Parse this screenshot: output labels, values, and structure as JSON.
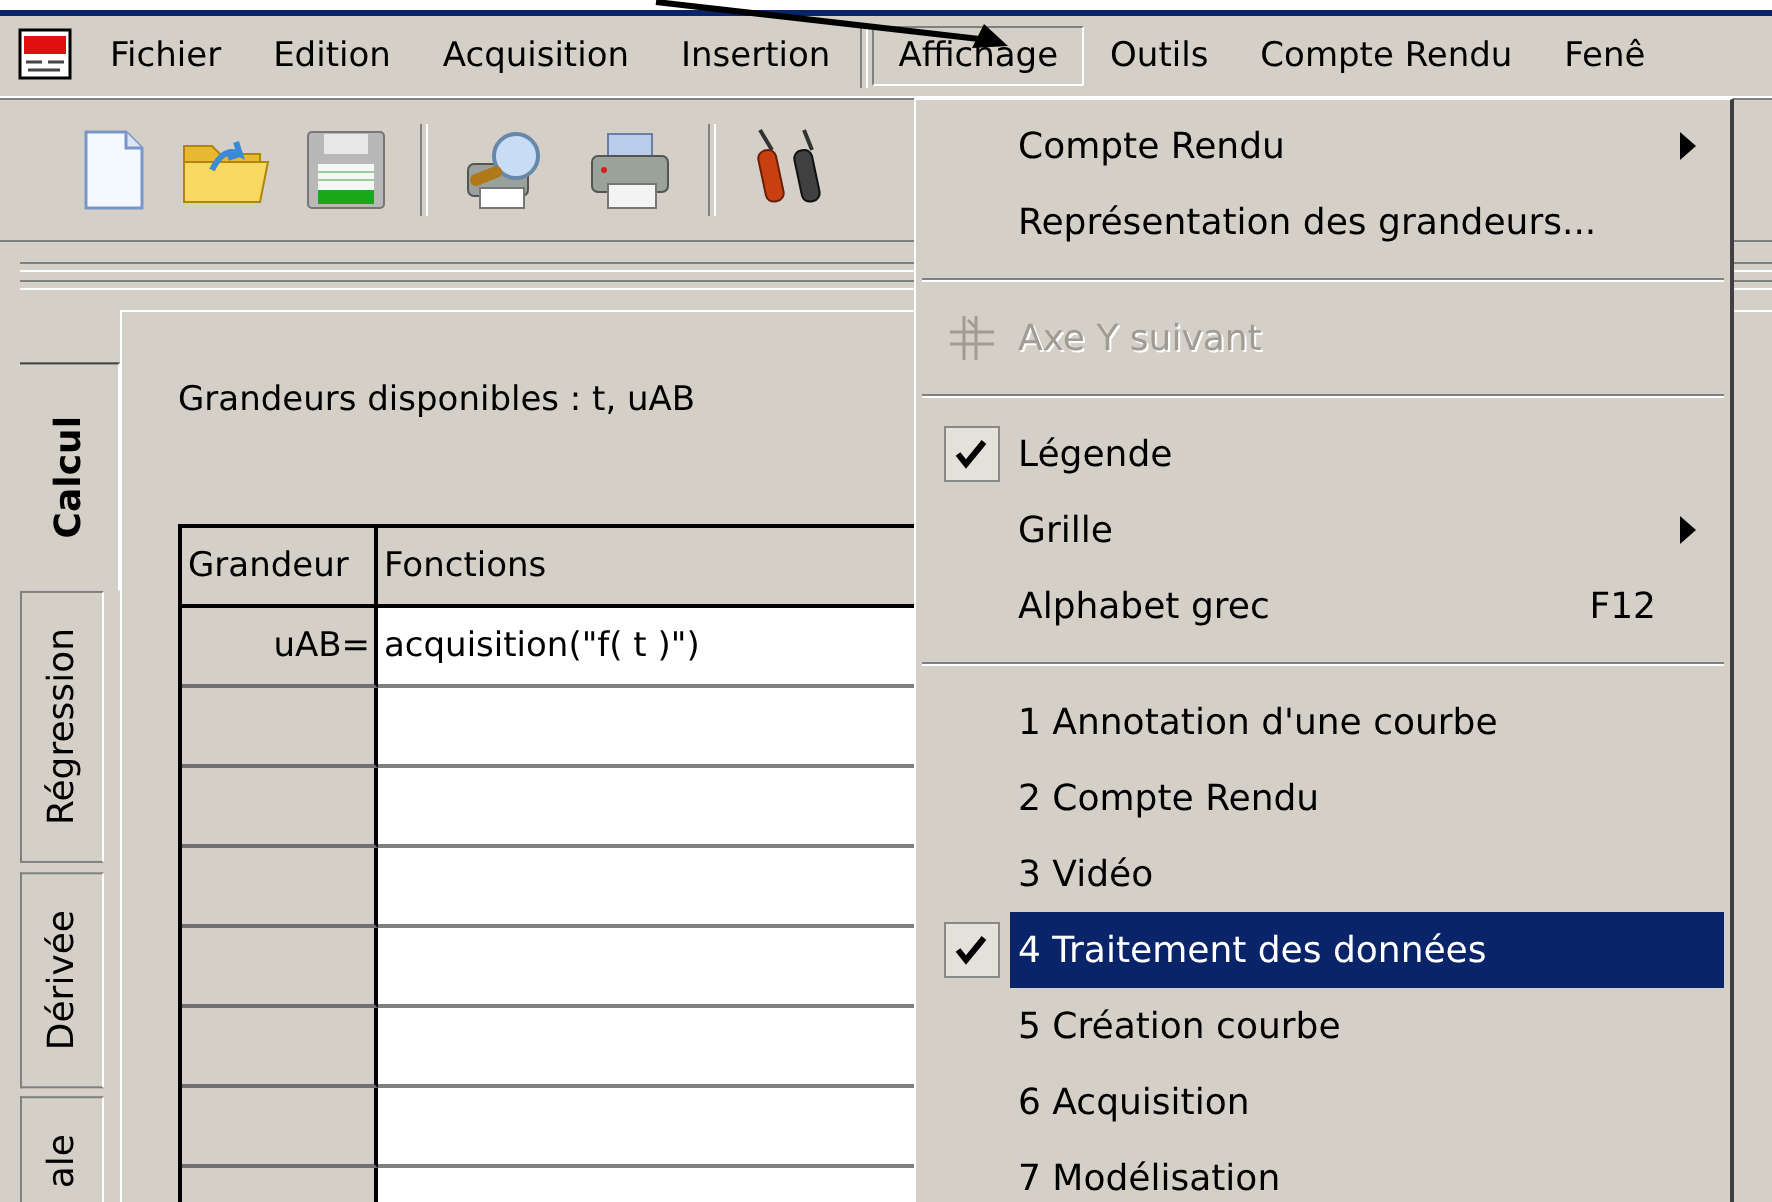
{
  "menu_bar": {
    "items": [
      {
        "label": "Fichier",
        "selected": false
      },
      {
        "label": "Edition",
        "selected": false
      },
      {
        "label": "Acquisition",
        "selected": false
      },
      {
        "label": "Insertion",
        "selected": false
      },
      {
        "label": "Affichage",
        "selected": true
      },
      {
        "label": "Outils",
        "selected": false
      },
      {
        "label": "Compte Rendu",
        "selected": false
      },
      {
        "label": "Fenê",
        "selected": false
      }
    ]
  },
  "side_tabs": [
    {
      "label": "Calcul",
      "selected": true
    },
    {
      "label": "Régression",
      "selected": false
    },
    {
      "label": "Dérivée",
      "selected": false
    },
    {
      "label": "ale",
      "selected": false
    }
  ],
  "panel": {
    "available": "Grandeurs disponibles : t, uAB"
  },
  "table": {
    "columns": [
      "Grandeur",
      "Fonctions"
    ],
    "rows": [
      {
        "name": "uAB=",
        "formula": "acquisition(\"f( t )\")"
      }
    ]
  },
  "dropdown": {
    "items": [
      {
        "kind": "item",
        "label": "Compte Rendu",
        "submenu": true,
        "checked": false,
        "disabled": false,
        "selected": false
      },
      {
        "kind": "item",
        "label": "Représentation des grandeurs...",
        "submenu": false,
        "checked": false,
        "disabled": false,
        "selected": false
      },
      {
        "kind": "separator"
      },
      {
        "kind": "icon-item",
        "label": "Axe Y suivant",
        "submenu": false,
        "checked": false,
        "disabled": true,
        "selected": false
      },
      {
        "kind": "separator"
      },
      {
        "kind": "item",
        "label": "Légende",
        "submenu": false,
        "checked": true,
        "disabled": false,
        "selected": false
      },
      {
        "kind": "item",
        "label": "Grille",
        "submenu": true,
        "checked": false,
        "disabled": false,
        "selected": false
      },
      {
        "kind": "item",
        "label": "Alphabet grec",
        "shortcut": "F12",
        "submenu": false,
        "checked": false,
        "disabled": false,
        "selected": false
      },
      {
        "kind": "separator"
      },
      {
        "kind": "item",
        "label": "1 Annotation d'une courbe",
        "submenu": false,
        "checked": false,
        "disabled": false,
        "selected": false
      },
      {
        "kind": "item",
        "label": "2 Compte Rendu",
        "submenu": false,
        "checked": false,
        "disabled": false,
        "selected": false
      },
      {
        "kind": "item",
        "label": "3 Vidéo",
        "submenu": false,
        "checked": false,
        "disabled": false,
        "selected": false
      },
      {
        "kind": "item",
        "label": "4 Traitement des données",
        "submenu": false,
        "checked": true,
        "disabled": false,
        "selected": true
      },
      {
        "kind": "item",
        "label": "5 Création courbe",
        "submenu": false,
        "checked": false,
        "disabled": false,
        "selected": false
      },
      {
        "kind": "item",
        "label": "6 Acquisition",
        "submenu": false,
        "checked": false,
        "disabled": false,
        "selected": false
      },
      {
        "kind": "item",
        "label": "7 Modélisation",
        "submenu": false,
        "checked": false,
        "disabled": false,
        "selected": false
      }
    ]
  }
}
